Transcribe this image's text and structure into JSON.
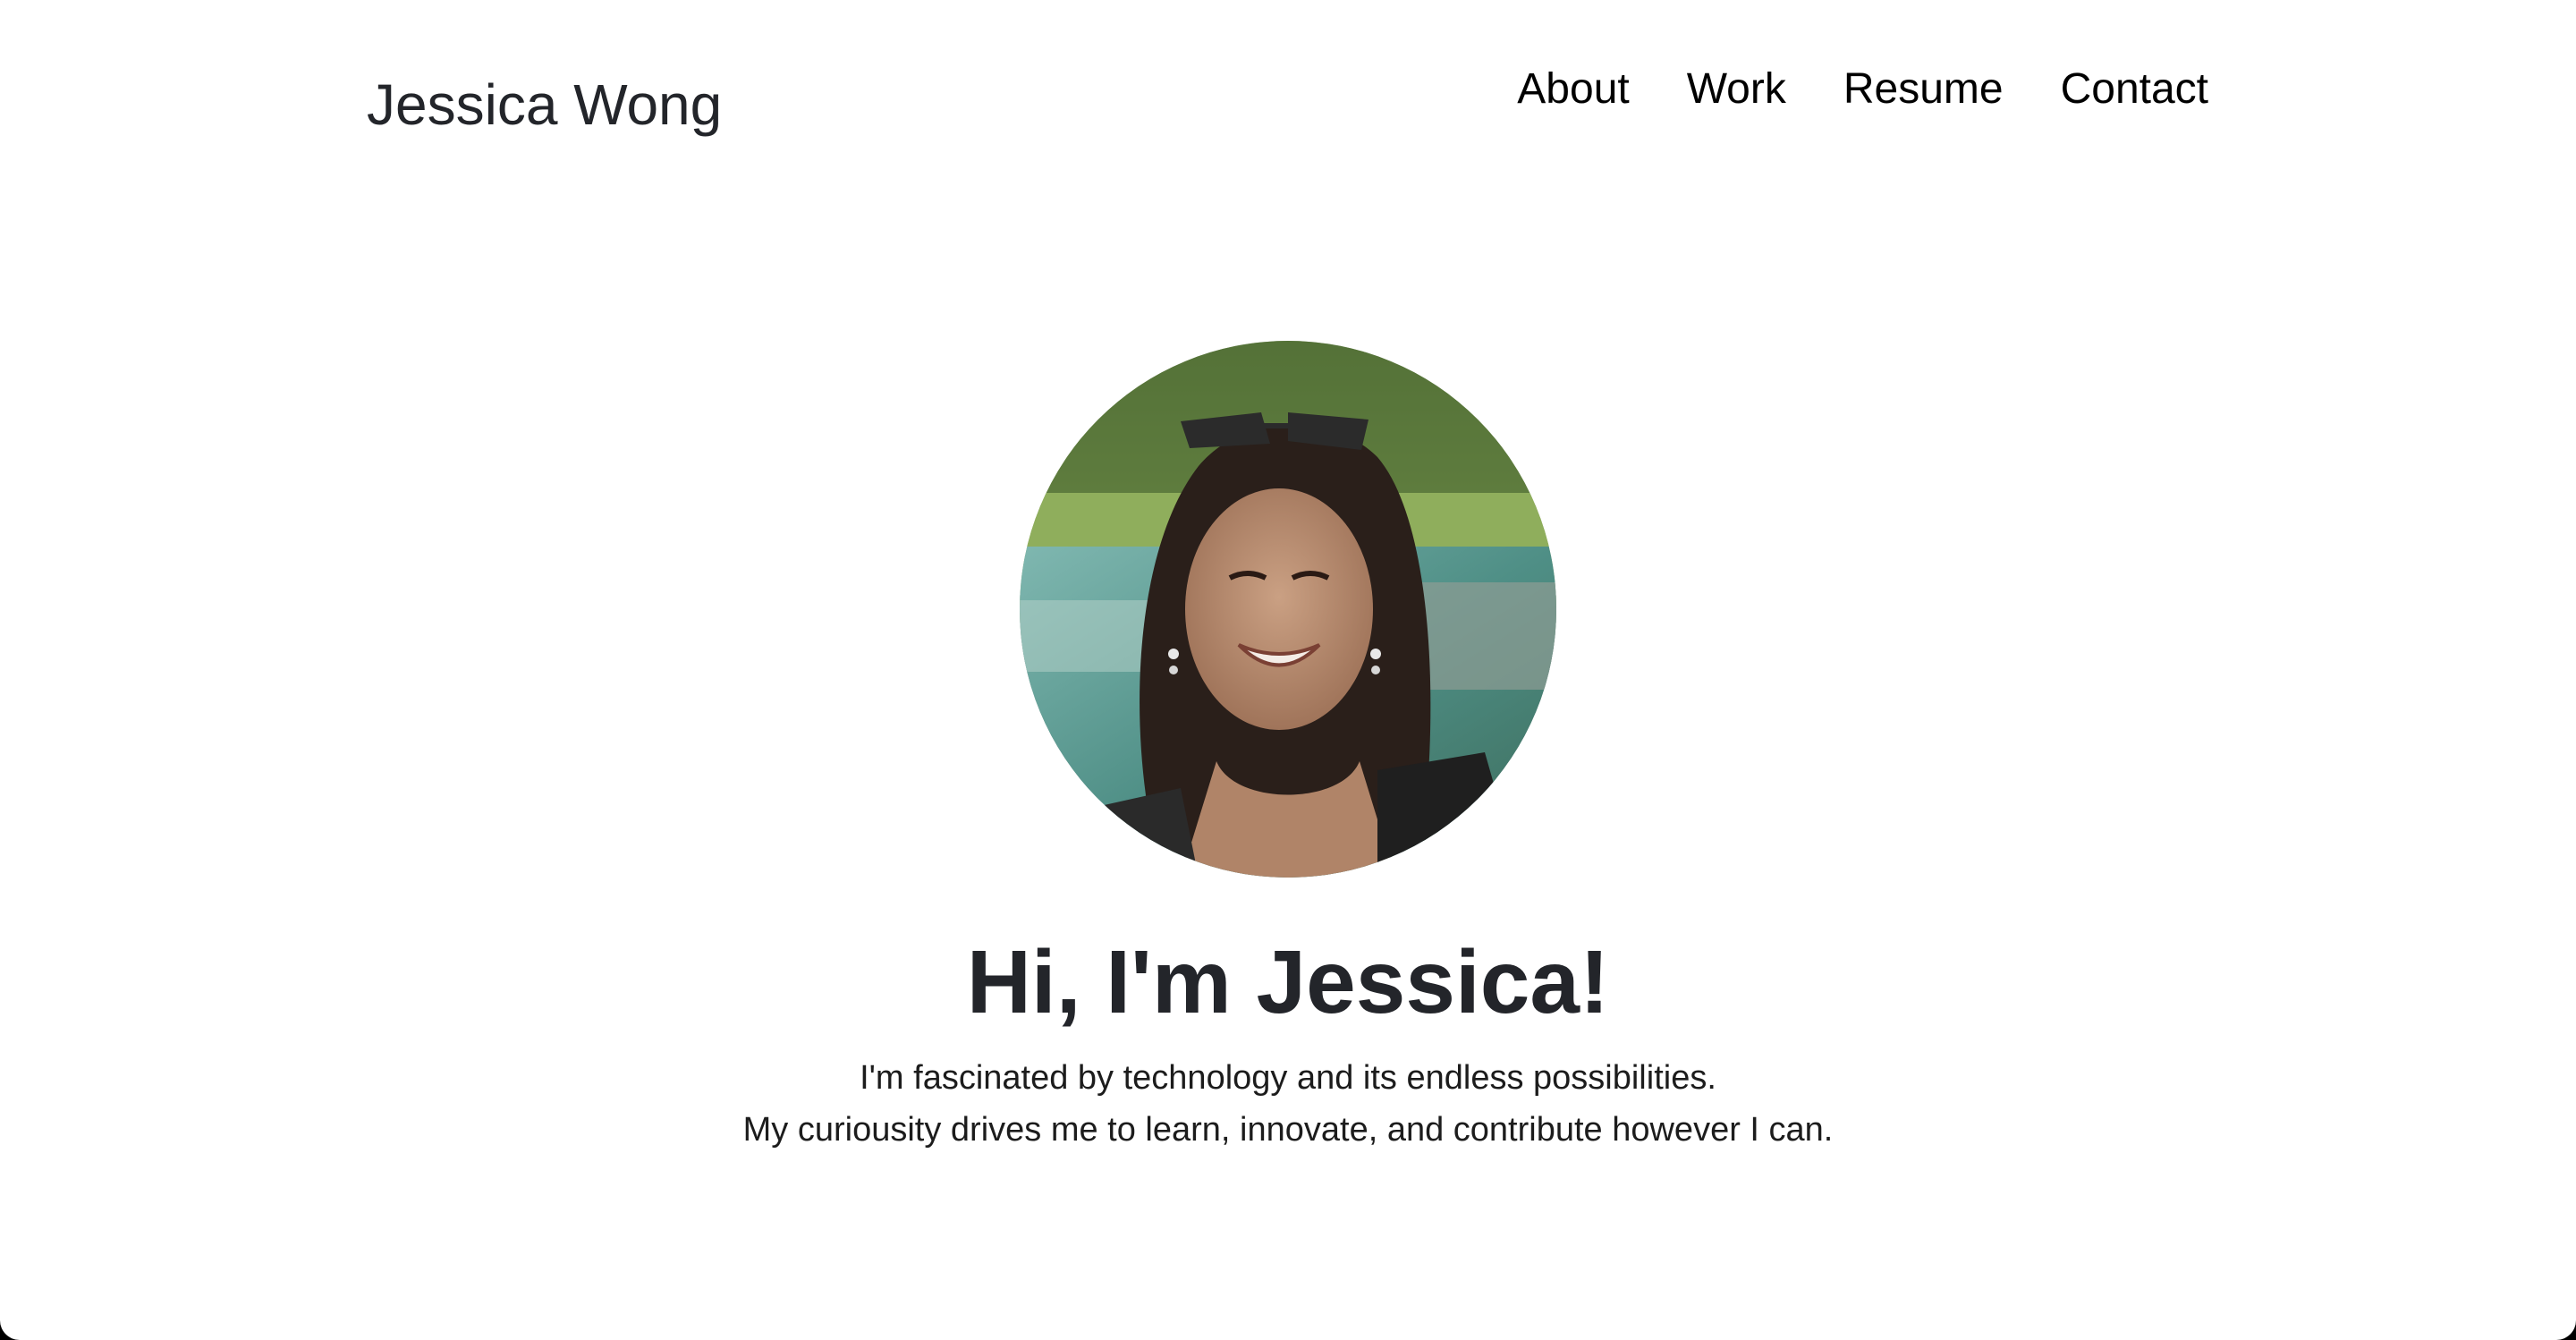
{
  "header": {
    "brand": "Jessica Wong",
    "nav": [
      "About",
      "Work",
      "Resume",
      "Contact"
    ]
  },
  "hero": {
    "heading": "Hi, I'm Jessica!",
    "lines": [
      "I'm fascinated by technology and its endless possibilities.",
      "My curiousity drives me to learn, innovate, and contribute however I can."
    ]
  }
}
